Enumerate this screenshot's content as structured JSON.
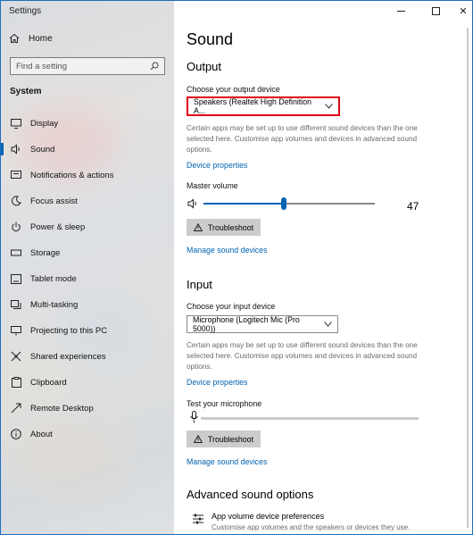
{
  "window": {
    "title": "Settings"
  },
  "sidebar": {
    "home_label": "Home",
    "search_placeholder": "Find a setting",
    "section_label": "System",
    "items": [
      {
        "label": "Display",
        "icon": "display-icon"
      },
      {
        "label": "Sound",
        "icon": "speaker-icon",
        "active": true
      },
      {
        "label": "Notifications & actions",
        "icon": "notification-icon"
      },
      {
        "label": "Focus assist",
        "icon": "moon-icon"
      },
      {
        "label": "Power & sleep",
        "icon": "power-icon"
      },
      {
        "label": "Storage",
        "icon": "storage-icon"
      },
      {
        "label": "Tablet mode",
        "icon": "tablet-icon"
      },
      {
        "label": "Multi-tasking",
        "icon": "multitasking-icon"
      },
      {
        "label": "Projecting to this PC",
        "icon": "projector-icon"
      },
      {
        "label": "Shared experiences",
        "icon": "shared-icon"
      },
      {
        "label": "Clipboard",
        "icon": "clipboard-icon"
      },
      {
        "label": "Remote Desktop",
        "icon": "remote-icon"
      },
      {
        "label": "About",
        "icon": "info-icon"
      }
    ]
  },
  "main": {
    "title": "Sound",
    "output": {
      "heading": "Output",
      "device_label": "Choose your output device",
      "device_value": "Speakers (Realtek High Definition A...",
      "description": "Certain apps may be set up to use different sound devices than the one selected here. Customise app volumes and devices in advanced sound options.",
      "properties_link": "Device properties",
      "volume_label": "Master volume",
      "volume_value": "47",
      "volume_level": 0.47,
      "troubleshoot_label": "Troubleshoot",
      "manage_link": "Manage sound devices"
    },
    "input": {
      "heading": "Input",
      "device_label": "Choose your input device",
      "device_value": "Microphone (Logitech Mic (Pro 5000))",
      "description": "Certain apps may be set up to use different sound devices than the one selected here. Customise app volumes and devices in advanced sound options.",
      "properties_link": "Device properties",
      "test_label": "Test your microphone",
      "troubleshoot_label": "Troubleshoot",
      "manage_link": "Manage sound devices"
    },
    "advanced": {
      "heading": "Advanced sound options",
      "item_title": "App volume  device preferences",
      "item_desc": "Customise app volumes and the speakers or devices they use."
    }
  },
  "colors": {
    "accent": "#0063b1",
    "highlight": "#e00017",
    "link": "#0063b1"
  }
}
